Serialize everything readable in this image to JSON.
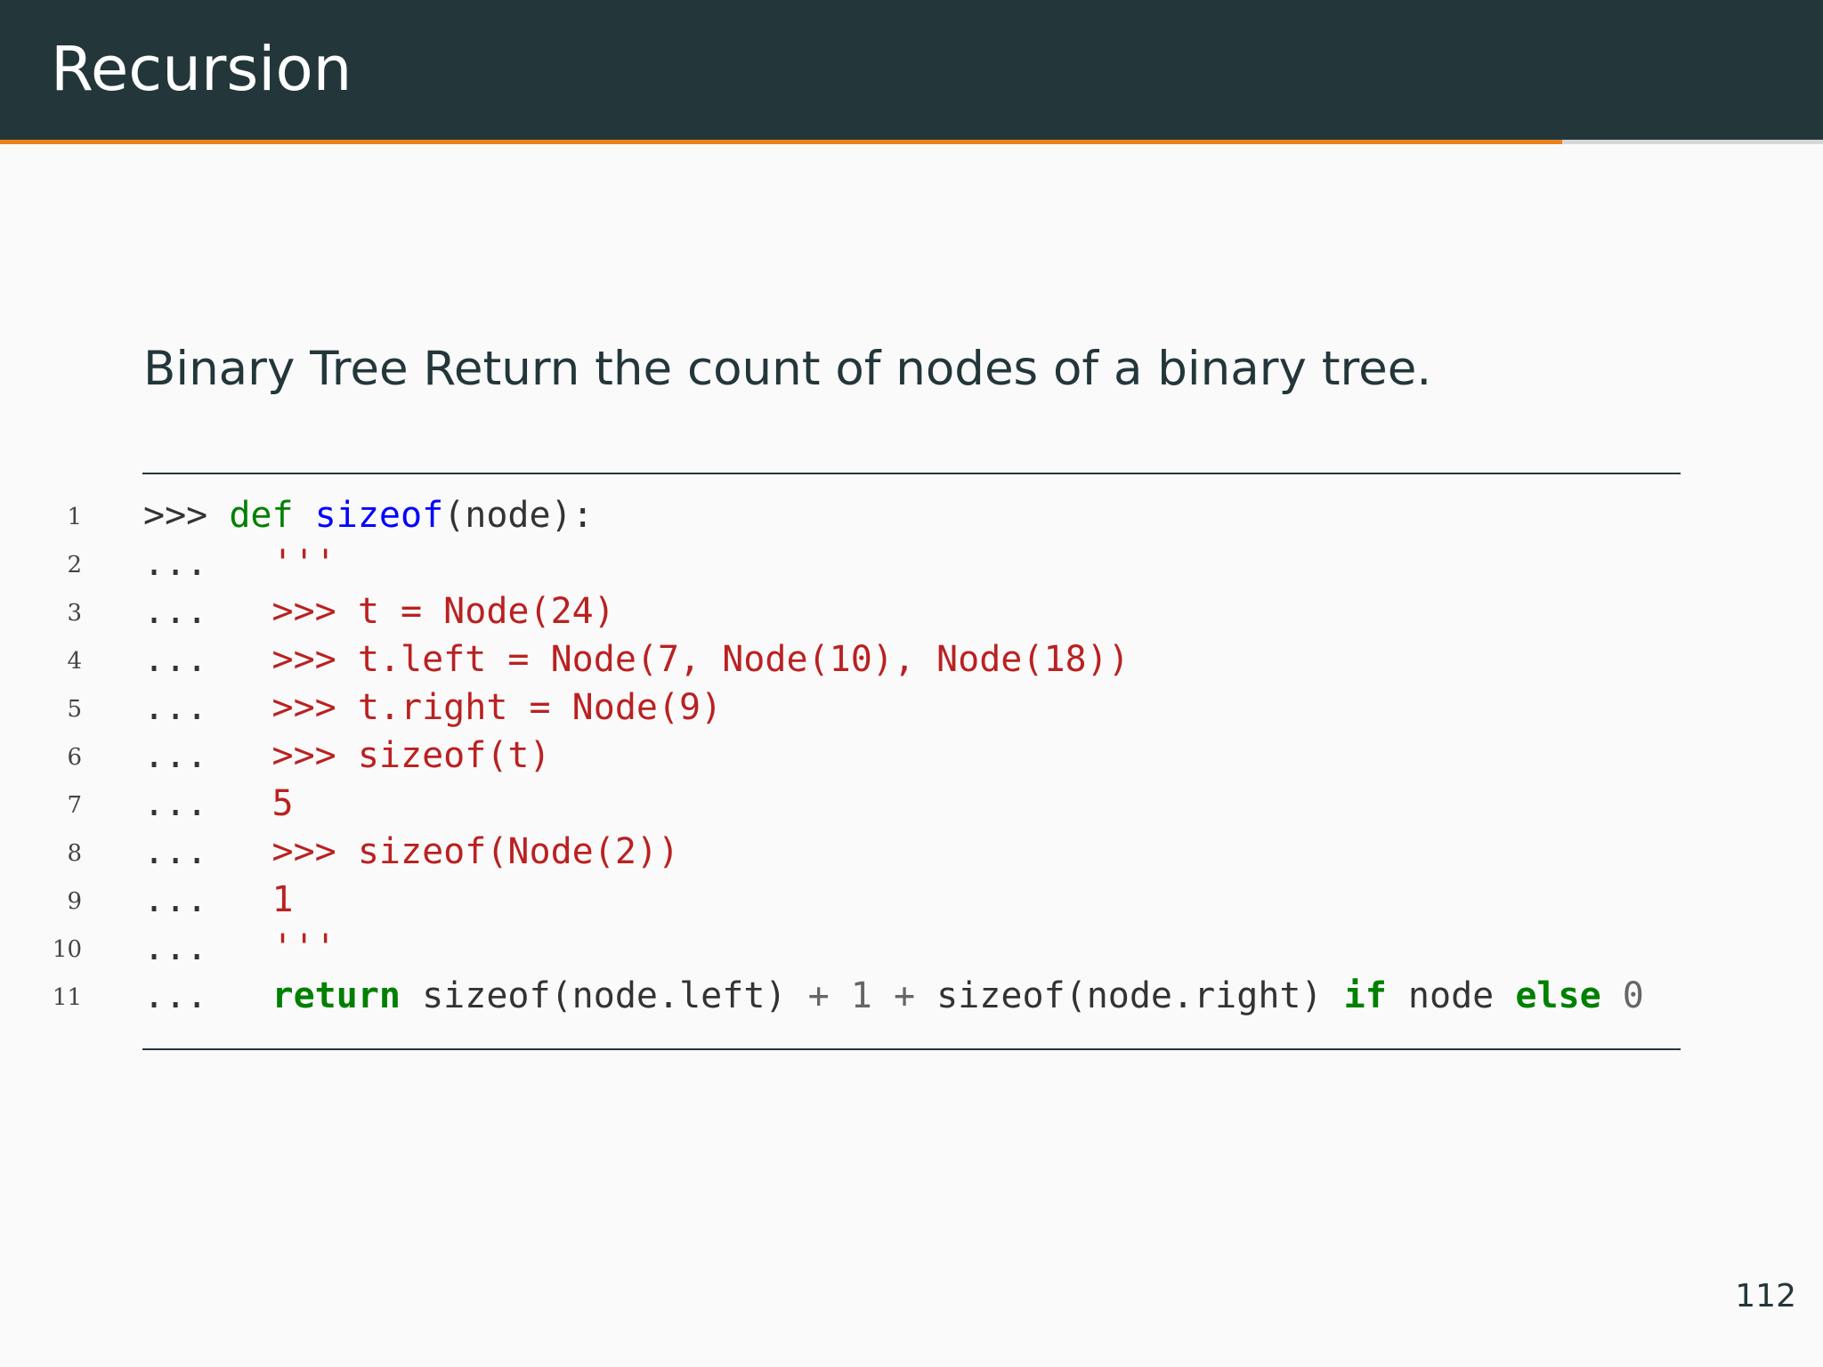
{
  "slide": {
    "title": "Recursion",
    "heading": "Binary Tree Return the count of nodes of a binary tree.",
    "page_number": "112",
    "progress": 0.857
  },
  "colors": {
    "header_bg": "#23373b",
    "accent": "#eb811b",
    "background": "#fafafa"
  },
  "code": {
    "lines": [
      {
        "n": "1",
        "tokens": [
          {
            "t": ">>> ",
            "c": "prompt"
          },
          {
            "t": "def",
            "c": "def"
          },
          {
            "t": " ",
            "c": "plain"
          },
          {
            "t": "sizeof",
            "c": "fn"
          },
          {
            "t": "(node):",
            "c": "plain"
          }
        ]
      },
      {
        "n": "2",
        "tokens": [
          {
            "t": "...   ",
            "c": "prompt"
          },
          {
            "t": "'''",
            "c": "str"
          }
        ]
      },
      {
        "n": "3",
        "tokens": [
          {
            "t": "...   ",
            "c": "prompt"
          },
          {
            "t": ">>> t = Node(24)",
            "c": "str"
          }
        ]
      },
      {
        "n": "4",
        "tokens": [
          {
            "t": "...   ",
            "c": "prompt"
          },
          {
            "t": ">>> t.left = Node(7, Node(10), Node(18))",
            "c": "str"
          }
        ]
      },
      {
        "n": "5",
        "tokens": [
          {
            "t": "...   ",
            "c": "prompt"
          },
          {
            "t": ">>> t.right = Node(9)",
            "c": "str"
          }
        ]
      },
      {
        "n": "6",
        "tokens": [
          {
            "t": "...   ",
            "c": "prompt"
          },
          {
            "t": ">>> sizeof(t)",
            "c": "str"
          }
        ]
      },
      {
        "n": "7",
        "tokens": [
          {
            "t": "...   ",
            "c": "prompt"
          },
          {
            "t": "5",
            "c": "str"
          }
        ]
      },
      {
        "n": "8",
        "tokens": [
          {
            "t": "...   ",
            "c": "prompt"
          },
          {
            "t": ">>> sizeof(Node(2))",
            "c": "str"
          }
        ]
      },
      {
        "n": "9",
        "tokens": [
          {
            "t": "...   ",
            "c": "prompt"
          },
          {
            "t": "1",
            "c": "str"
          }
        ]
      },
      {
        "n": "10",
        "tokens": [
          {
            "t": "...   ",
            "c": "prompt"
          },
          {
            "t": "'''",
            "c": "str"
          }
        ]
      },
      {
        "n": "11",
        "tokens": [
          {
            "t": "...   ",
            "c": "prompt"
          },
          {
            "t": "return",
            "c": "kw"
          },
          {
            "t": " sizeof(node.left) ",
            "c": "plain"
          },
          {
            "t": "+",
            "c": "op"
          },
          {
            "t": " ",
            "c": "plain"
          },
          {
            "t": "1",
            "c": "num"
          },
          {
            "t": " ",
            "c": "plain"
          },
          {
            "t": "+",
            "c": "op"
          },
          {
            "t": " sizeof(node.right) ",
            "c": "plain"
          },
          {
            "t": "if",
            "c": "kw"
          },
          {
            "t": " node ",
            "c": "plain"
          },
          {
            "t": "else",
            "c": "kw"
          },
          {
            "t": " ",
            "c": "plain"
          },
          {
            "t": "0",
            "c": "num"
          }
        ]
      }
    ]
  }
}
